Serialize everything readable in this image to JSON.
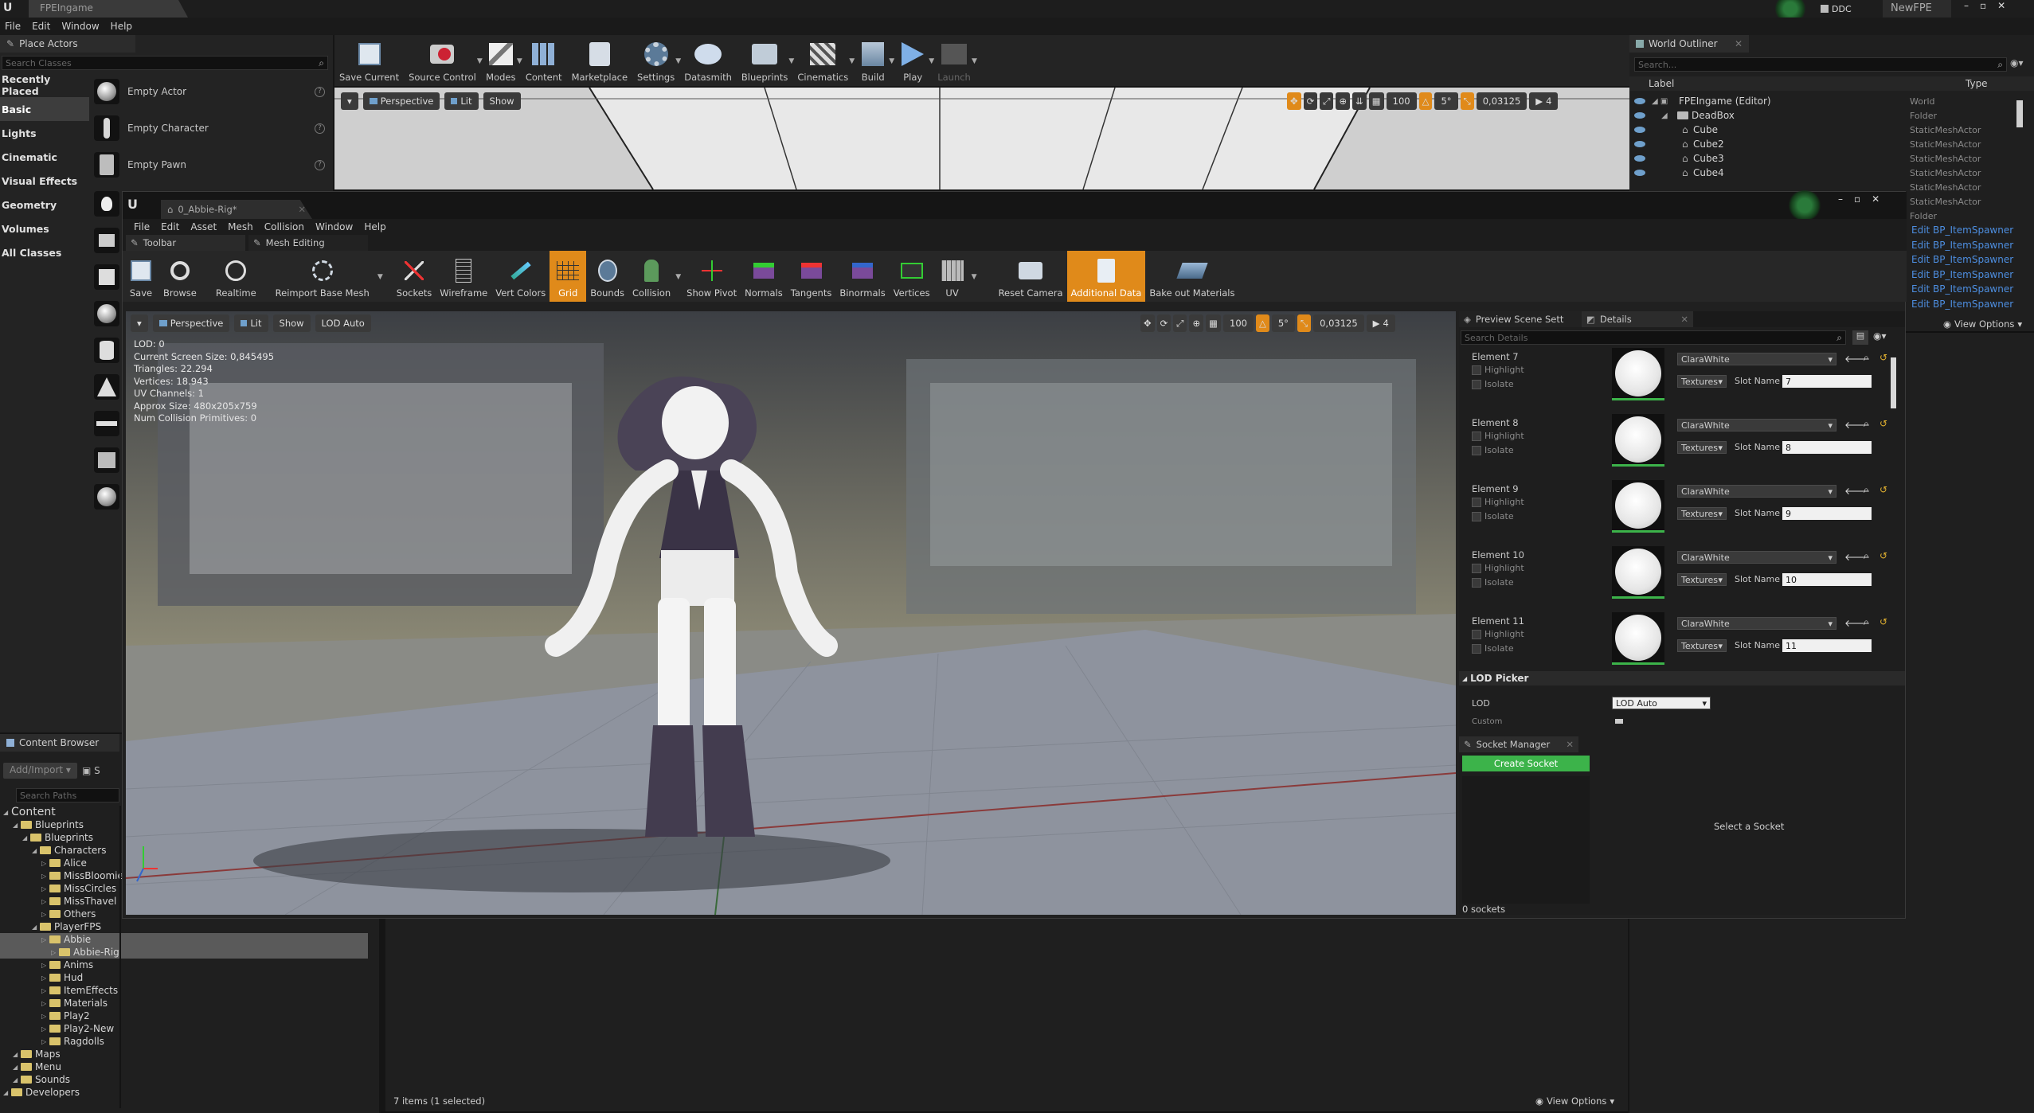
{
  "app": {
    "title_tab": "FPEIngame",
    "menu": [
      "File",
      "Edit",
      "Window",
      "Help"
    ],
    "right_badges": [
      "DDC",
      "NewFPE"
    ]
  },
  "place_actors": {
    "tab_label": "Place Actors",
    "search_placeholder": "Search Classes",
    "categories": [
      "Recently Placed",
      "Basic",
      "Lights",
      "Cinematic",
      "Visual Effects",
      "Geometry",
      "Volumes",
      "All Classes"
    ],
    "selected_category": "Basic",
    "actors": [
      "Empty Actor",
      "Empty Character",
      "Empty Pawn"
    ]
  },
  "main_toolbar": {
    "buttons": [
      "Save Current",
      "Source Control",
      "Modes",
      "Content",
      "Marketplace",
      "Settings",
      "Datasmith",
      "Blueprints",
      "Cinematics",
      "Build",
      "Play",
      "Launch"
    ]
  },
  "main_viewport": {
    "perspective": "Perspective",
    "lit": "Lit",
    "show": "Show",
    "grid_size": "100",
    "rot_snap": "5°",
    "scale_snap": "0,03125",
    "cam_speed": "4"
  },
  "world_outliner": {
    "tab_label": "World Outliner",
    "search_placeholder": "Search...",
    "col_label": "Label",
    "col_type": "Type",
    "rows": [
      {
        "label": "FPEIngame (Editor)",
        "type": "World"
      },
      {
        "label": "DeadBox",
        "type": "Folder"
      },
      {
        "label": "Cube",
        "type": "StaticMeshActor"
      },
      {
        "label": "Cube2",
        "type": "StaticMeshActor"
      },
      {
        "label": "Cube3",
        "type": "StaticMeshActor"
      },
      {
        "label": "Cube4",
        "type": "StaticMeshActor"
      }
    ],
    "extra_types": [
      "StaticMeshActor",
      "StaticMeshActor",
      "Folder"
    ],
    "links": [
      "Edit BP_ItemSpawner",
      "Edit BP_ItemSpawner",
      "Edit BP_ItemSpawner",
      "Edit BP_ItemSpawner",
      "Edit BP_ItemSpawner",
      "Edit BP_ItemSpawner"
    ],
    "view_options": "View Options"
  },
  "content_browser": {
    "tab_label": "Content Browser",
    "add_import": "Add/Import",
    "search_placeholder": "Search Paths",
    "tree": [
      {
        "label": "Content",
        "depth": 0
      },
      {
        "label": "Blueprints",
        "depth": 1
      },
      {
        "label": "Blueprints",
        "depth": 2
      },
      {
        "label": "Characters",
        "depth": 3
      },
      {
        "label": "Alice",
        "depth": 4
      },
      {
        "label": "MissBloomie",
        "depth": 4
      },
      {
        "label": "MissCircles",
        "depth": 4
      },
      {
        "label": "MissThavel",
        "depth": 4
      },
      {
        "label": "Others",
        "depth": 4
      },
      {
        "label": "PlayerFPS",
        "depth": 3
      },
      {
        "label": "Abbie",
        "depth": 4
      },
      {
        "label": "Abbie-Rig",
        "depth": 5
      },
      {
        "label": "Anims",
        "depth": 4
      },
      {
        "label": "Hud",
        "depth": 4
      },
      {
        "label": "ItemEffects",
        "depth": 4
      },
      {
        "label": "Materials",
        "depth": 4
      },
      {
        "label": "Play2",
        "depth": 4
      },
      {
        "label": "Play2-New",
        "depth": 4
      },
      {
        "label": "Ragdolls",
        "depth": 4
      },
      {
        "label": "Maps",
        "depth": 1
      },
      {
        "label": "Menu",
        "depth": 1
      },
      {
        "label": "Sounds",
        "depth": 1
      },
      {
        "label": "Developers",
        "depth": 0
      }
    ],
    "items_count": "7 items (1 selected)",
    "view_options": "View Options"
  },
  "mesh_editor": {
    "doc_tab": "0_Abbie-Rig*",
    "menu": [
      "File",
      "Edit",
      "Asset",
      "Mesh",
      "Collision",
      "Window",
      "Help"
    ],
    "tabs": [
      "Toolbar",
      "Mesh Editing"
    ],
    "toolbar": [
      "Save",
      "Browse",
      "Realtime",
      "Reimport Base Mesh",
      "Sockets",
      "Wireframe",
      "Vert Colors",
      "Grid",
      "Bounds",
      "Collision",
      "Show Pivot",
      "Normals",
      "Tangents",
      "Binormals",
      "Vertices",
      "UV",
      "Reset Camera",
      "Additional Data",
      "Bake out Materials"
    ],
    "active_tools": [
      "Grid",
      "Additional Data"
    ],
    "viewport": {
      "perspective": "Perspective",
      "lit": "Lit",
      "show": "Show",
      "lod": "LOD Auto",
      "grid_size": "100",
      "rot_snap": "5°",
      "scale_snap": "0,03125",
      "cam_speed": "4",
      "stats": [
        "LOD:  0",
        "Current Screen Size:  0,845495",
        "Triangles:  22.294",
        "Vertices:  18.943",
        "UV Channels:  1",
        "Approx Size: 480x205x759",
        "Num Collision Primitives:  0"
      ]
    },
    "details": {
      "tabs": [
        "Preview Scene Sett",
        "Details"
      ],
      "search_placeholder": "Search Details",
      "highlight": "Highlight",
      "isolate": "Isolate",
      "textures": "Textures",
      "slot_name_label": "Slot Name",
      "elements": [
        {
          "name": "Element 7",
          "material": "ClaraWhite",
          "slot": "7"
        },
        {
          "name": "Element 8",
          "material": "ClaraWhite",
          "slot": "8"
        },
        {
          "name": "Element 9",
          "material": "ClaraWhite",
          "slot": "9"
        },
        {
          "name": "Element 10",
          "material": "ClaraWhite",
          "slot": "10"
        },
        {
          "name": "Element 11",
          "material": "ClaraWhite",
          "slot": "11"
        }
      ],
      "lod_picker": "LOD Picker",
      "lod_label": "LOD",
      "lod_value": "LOD Auto",
      "custom": "Custom"
    },
    "socket_manager": {
      "tab": "Socket Manager",
      "create": "Create Socket",
      "select_msg": "Select a Socket",
      "count": "0 sockets"
    }
  },
  "colors": {
    "accent_orange": "#e08a1a",
    "create_green": "#3cb34a",
    "link_blue": "#4d8ee0"
  }
}
